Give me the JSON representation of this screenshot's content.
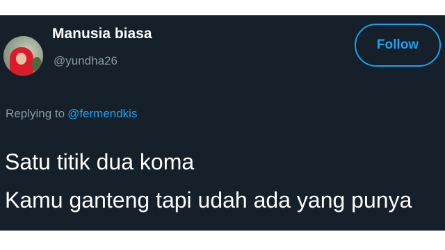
{
  "tweet": {
    "display_name": "Manusia biasa",
    "handle": "@yundha26",
    "follow_label": "Follow",
    "replying_to_prefix": "Replying to",
    "replying_to_handle": "@fermendkis",
    "text_lines": [
      "Satu titik dua koma",
      "Kamu ganteng tapi udah ada yang punya"
    ]
  },
  "colors": {
    "background": "#15202b",
    "accent": "#1da1f2",
    "secondary_text": "#8899a6",
    "primary_text": "#ffffff"
  },
  "icons": {
    "avatar": "user-avatar"
  }
}
